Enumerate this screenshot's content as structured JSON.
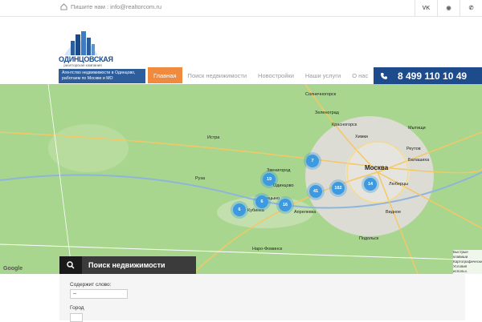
{
  "topbar": {
    "email_text": "Пишите нам : info@realtorcom.ru"
  },
  "social": [
    {
      "label": "VK"
    },
    {
      "label": "◉"
    },
    {
      "label": "✆"
    }
  ],
  "logo": {
    "name": "ОДИНЦОВСКАЯ",
    "sub": "риэлторская компания"
  },
  "tagline": "Агентство недвижимости в Одинцово, работаем по Москве и МО",
  "nav": [
    {
      "label": "Главная",
      "active": true
    },
    {
      "label": "Поиск недвижимости"
    },
    {
      "label": "Новостройки"
    },
    {
      "label": "Наши услуги"
    },
    {
      "label": "О нас"
    }
  ],
  "phone": "8 499 110 10 49",
  "map": {
    "labels": [
      "Москва",
      "Мытищи",
      "Химки",
      "Зеленоград",
      "Балашиха",
      "Люберцы",
      "Одинцово",
      "Кубинка",
      "Звенигород",
      "Подольск",
      "Наро-Фоминск",
      "Истра",
      "Руза",
      "Видное",
      "Красногорск",
      "Солнечногорск",
      "Реутов",
      "Апрелевка",
      "Голицыно"
    ],
    "clusters": [
      "7",
      "19",
      "41",
      "162",
      "14",
      "6",
      "16",
      "6"
    ],
    "google": "Google",
    "credit": "Быстрые клавиши Картографические Условия использ."
  },
  "search": {
    "title": "Поиск недвижимости"
  },
  "form": {
    "keyword_label": "Содержит слово:",
    "keyword_value": "--",
    "city_label": "Город"
  }
}
